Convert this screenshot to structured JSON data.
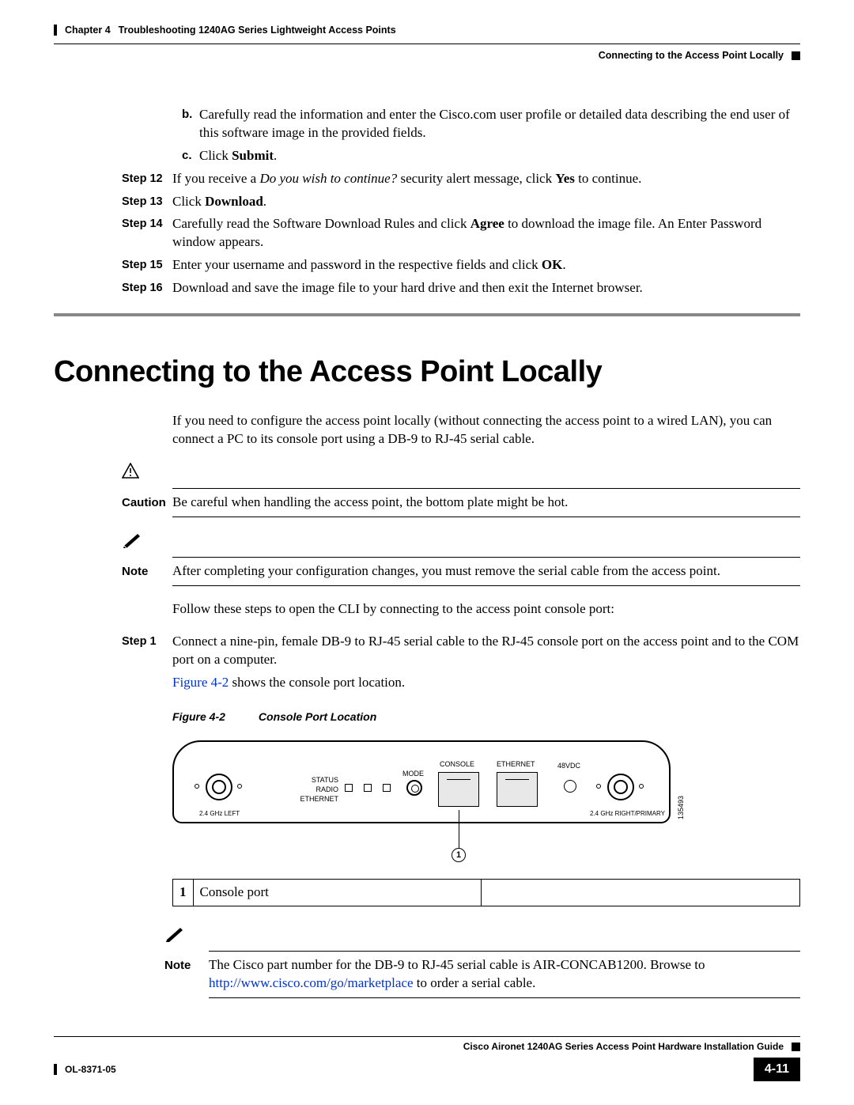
{
  "header": {
    "chapter": "Chapter 4",
    "title": "Troubleshooting 1240AG Series Lightweight Access Points",
    "section": "Connecting to the Access Point Locally"
  },
  "substeps": {
    "b": {
      "label": "b.",
      "text": "Carefully read the information and enter the Cisco.com user profile or detailed data describing the end user of this software image in the provided fields."
    },
    "c": {
      "label": "c.",
      "prefix": "Click ",
      "bold": "Submit",
      "suffix": "."
    }
  },
  "steps": {
    "s12": {
      "label": "Step 12",
      "pre": "If you receive a ",
      "it": "Do you wish to continue?",
      "mid": " security alert message, click ",
      "b": "Yes",
      "post": " to continue."
    },
    "s13": {
      "label": "Step 13",
      "pre": "Click ",
      "b": "Download",
      "post": "."
    },
    "s14": {
      "label": "Step 14",
      "pre": "Carefully read the Software Download Rules and click ",
      "b": "Agree",
      "post": " to download the image file. An Enter Password window appears."
    },
    "s15": {
      "label": "Step 15",
      "pre": "Enter your username and password in the respective fields and click ",
      "b": "OK",
      "post": "."
    },
    "s16": {
      "label": "Step 16",
      "text": "Download and save the image file to your hard drive and then exit the Internet browser."
    }
  },
  "h1": "Connecting to the Access Point Locally",
  "intro": "If you need to configure the access point locally (without connecting the access point to a wired LAN), you can connect a PC to its console port using a DB-9 to RJ-45 serial cable.",
  "caution": {
    "label": "Caution",
    "text": "Be careful when handling the access point, the bottom plate might be hot."
  },
  "note1": {
    "label": "Note",
    "text": "After completing your configuration changes, you must remove the serial cable from the access point."
  },
  "follow": "Follow these steps to open the CLI by connecting to the access point console port:",
  "step1": {
    "label": "Step 1",
    "text": "Connect a nine-pin, female DB-9 to RJ-45 serial cable to the RJ-45 console port on the access point and to the COM port on a computer."
  },
  "figref": {
    "link": "Figure 4-2",
    "text": " shows the console port location."
  },
  "figcap": {
    "num": "Figure 4-2",
    "title": "Console Port Location"
  },
  "diagram": {
    "console": "CONSOLE",
    "ethernet": "ETHERNET",
    "vdc": "48VDC",
    "mode": "MODE",
    "status": "STATUS",
    "radio": "RADIO",
    "eth": "ETHERNET",
    "left": "2.4 GHz LEFT",
    "right": "2.4 GHz RIGHT/PRIMARY",
    "id": "135493",
    "callnum": "1"
  },
  "legend": {
    "num": "1",
    "text": "Console port"
  },
  "note2": {
    "label": "Note",
    "pre": "The Cisco part number for the DB-9 to RJ-45 serial cable is AIR-CONCAB1200. Browse to ",
    "link": "http://www.cisco.com/go/marketplace",
    "post": " to order a serial cable."
  },
  "footer": {
    "guide": "Cisco Aironet 1240AG Series Access Point Hardware Installation Guide",
    "doc": "OL-8371-05",
    "page": "4-11"
  }
}
